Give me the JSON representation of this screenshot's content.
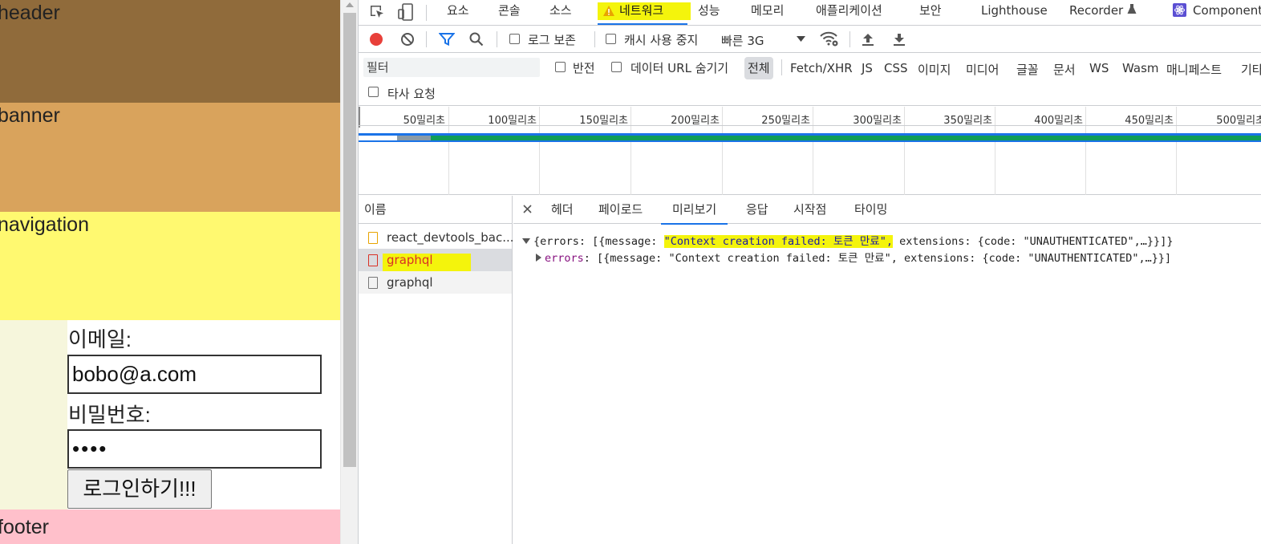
{
  "page": {
    "header": "header",
    "banner": "banner",
    "navigation": "navigation",
    "footer": "footer",
    "email_label": "이메일:",
    "email_value": "bobo@a.com",
    "password_label": "비밀번호:",
    "password_value": "••••",
    "login_button": "로그인하기!!!"
  },
  "devtools": {
    "tabs": [
      "요소",
      "콘솔",
      "소스",
      "네트워크",
      "성능",
      "메모리",
      "애플리케이션",
      "보안",
      "Lighthouse",
      "Recorder",
      "Component"
    ],
    "active_tab": "네트워크",
    "toolbar": {
      "preserve_log": "로그 보존",
      "disable_cache": "캐시 사용 중지",
      "throttle": "빠른 3G"
    },
    "filter": {
      "placeholder": "필터",
      "invert": "반전",
      "hide_data_urls": "데이터 URL 숨기기",
      "all": "전체",
      "types": [
        "Fetch/XHR",
        "JS",
        "CSS",
        "이미지",
        "미디어",
        "글꼴",
        "문서",
        "WS",
        "Wasm",
        "매니페스트",
        "기타"
      ],
      "third_party": "타사 요청"
    },
    "timeline": {
      "ticks": [
        "50밀리초",
        "100밀리초",
        "150밀리초",
        "200밀리초",
        "250밀리초",
        "300밀리초",
        "350밀리초",
        "400밀리초",
        "450밀리초",
        "500밀리초"
      ]
    },
    "requests": {
      "header": "이름",
      "items": [
        {
          "name": "react_devtools_bac...",
          "status": "normal"
        },
        {
          "name": "graphql",
          "status": "error"
        },
        {
          "name": "graphql",
          "status": "normal"
        }
      ]
    },
    "detail": {
      "tabs": [
        "헤더",
        "페이로드",
        "미리보기",
        "응답",
        "시작점",
        "타이밍"
      ],
      "active_tab": "미리보기",
      "line1_prefix": "{errors: [{message: ",
      "line1_message": "\"Context creation failed: 토큰 만료\",",
      "line1_suffix": " extensions: {code: \"UNAUTHENTICATED\",…}}]}",
      "line2_key": "errors",
      "line2_value": ": [{message: \"Context creation failed: 토큰 만료\", extensions: {code: \"UNAUTHENTICATED\",…}}]"
    },
    "colors": {
      "highlight": "#f4f40c",
      "accent": "#1a73e8",
      "record": "#e8403a",
      "error": "#d93025"
    }
  }
}
